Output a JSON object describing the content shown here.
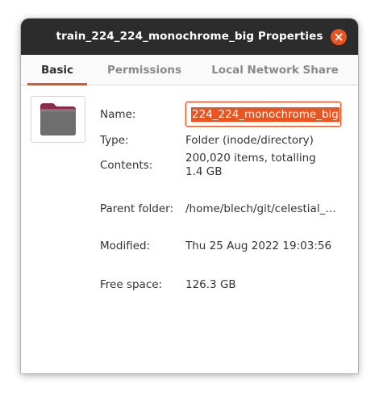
{
  "window": {
    "title": "train_224_224_monochrome_big Properties"
  },
  "tabs": [
    {
      "label": "Basic",
      "active": true
    },
    {
      "label": "Permissions",
      "active": false
    },
    {
      "label": "Local Network Share",
      "active": false
    }
  ],
  "folder_icon": {
    "icon": "folder-icon",
    "colors": {
      "front": "#6e6e6e",
      "back": "#8d2a4f"
    }
  },
  "properties": {
    "name_label": "Name:",
    "name_value": "224_224_monochrome_big",
    "type_label": "Type:",
    "type_value": "Folder (inode/directory)",
    "contents_label": "Contents:",
    "contents_value": "200,020 items, totalling 1.4 GB",
    "parent_label": "Parent folder:",
    "parent_value": "/home/blech/git/celestial_…",
    "modified_label": "Modified:",
    "modified_value": "Thu 25 Aug 2022 19:03:56",
    "free_label": "Free space:",
    "free_value": "126.3 GB"
  },
  "colors": {
    "accent": "#e95420",
    "titlebar": "#2c2c2c"
  }
}
